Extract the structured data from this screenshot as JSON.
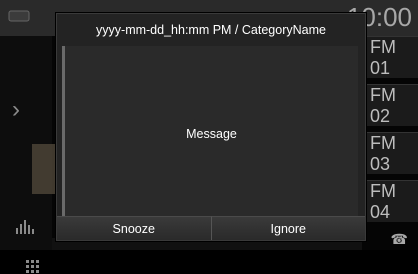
{
  "background": {
    "clock": "10:00",
    "presets": [
      "FM 01",
      "FM 02",
      "FM 03",
      "FM 04"
    ]
  },
  "dialog": {
    "title": "yyyy-mm-dd_hh:mm PM / CategoryName",
    "message": "Message",
    "buttons": {
      "snooze": "Snooze",
      "ignore": "Ignore"
    }
  },
  "colors": {
    "dialog_bg": "#232323",
    "body_bg": "#2a2a2a",
    "text": "#ffffff"
  }
}
